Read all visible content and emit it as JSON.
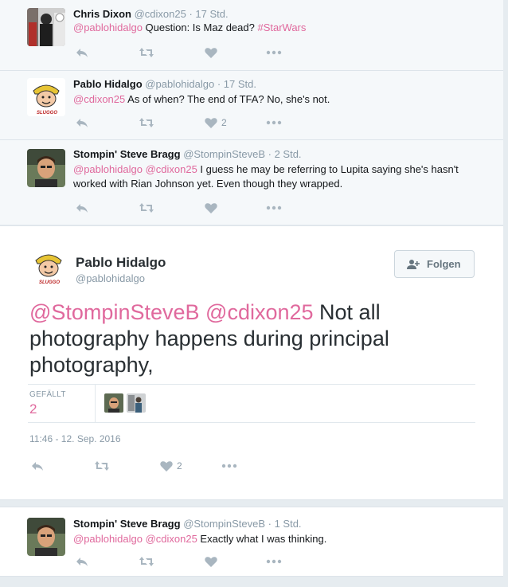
{
  "tweets_above": [
    {
      "name": "Chris Dixon",
      "handle": "@cdixon25",
      "time": "· 17 Std.",
      "mention": "@pablohidalgo",
      "text": " Question: Is Maz dead? ",
      "hashtag": "#StarWars",
      "like_count": ""
    },
    {
      "name": "Pablo Hidalgo",
      "handle": "@pablohidalgo",
      "time": "· 17 Std.",
      "mention": "@cdixon25",
      "text": " As of when? The end of TFA? No, she's not.",
      "like_count": "2"
    },
    {
      "name": "Stompin' Steve Bragg",
      "handle": "@StompinSteveB",
      "time": "· 2 Std.",
      "mention1": "@pablohidalgo",
      "mention2": "@cdixon25",
      "text": " I guess he may be referring to Lupita saying she's hasn't worked with Rian Johnson yet. Even though they wrapped.",
      "like_count": ""
    }
  ],
  "main_tweet": {
    "name": "Pablo Hidalgo",
    "handle": "@pablohidalgo",
    "follow_label": "Folgen",
    "mention1": "@StompinSteveB",
    "mention2": "@cdixon25",
    "text": " Not all photography happens during principal photography,",
    "likes_label": "GEFÄLLT",
    "likes_count": "2",
    "timestamp": "11:46 - 12. Sep. 2016",
    "like_count": "2"
  },
  "reply_below": {
    "name": "Stompin' Steve Bragg",
    "handle": "@StompinSteveB",
    "time": "· 1 Std.",
    "mention1": "@pablohidalgo",
    "mention2": "@cdixon25",
    "text": " Exactly what I was thinking."
  },
  "colors": {
    "link": "#e0699d",
    "icon": "#a9b6c0",
    "muted": "#8899a6"
  },
  "avatar_logo_text": "SLUGGO"
}
